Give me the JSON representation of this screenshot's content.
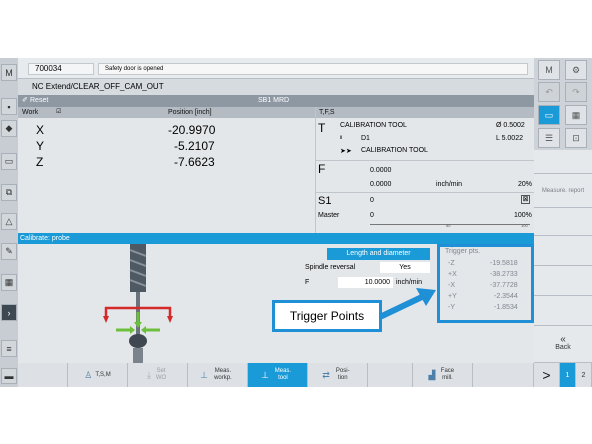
{
  "header": {
    "channel": "700034",
    "alarm": "Safety door is opened",
    "program": "NC Extend/CLEAR_OFF_CAM_OUT",
    "reset_label": "Reset",
    "mode": "SB1 MRD"
  },
  "position": {
    "col_work": "Work",
    "col_pos": "Position [inch]",
    "axes": [
      {
        "name": "X",
        "value": "-20.9970"
      },
      {
        "name": "Y",
        "value": "-5.2107"
      },
      {
        "name": "Z",
        "value": "-7.6623"
      }
    ]
  },
  "tfs": {
    "title": "T,F,S",
    "t_letter": "T",
    "tool": "CALIBRATION TOOL",
    "diameter": "Ø 0.5002",
    "d_num": "D1",
    "length": "L 5.0022",
    "next_tool": "CALIBRATION TOOL",
    "f_letter": "F",
    "f1": "0.0000",
    "f2": "0.0000",
    "f_unit": "inch/min",
    "f_pct": "20%",
    "s_letter": "S1",
    "s_val": "0",
    "master_label": "Master",
    "master_val": "0",
    "master_pct": "100%",
    "scale_mid": "50",
    "scale_max": "100"
  },
  "calib": {
    "title": "Calibrate: probe",
    "field_label": "Length and diameter",
    "spindle_label": "Spindle reversal",
    "spindle_value": "Yes",
    "f_label": "F",
    "f_value": "10.0000",
    "f_unit": "inch/min"
  },
  "trigger": {
    "title": "Trigger pts.",
    "points": [
      {
        "axis": "-Z",
        "value": "-19.5818"
      },
      {
        "axis": "+X",
        "value": "-38.2733"
      },
      {
        "axis": "-X",
        "value": "-37.7728"
      },
      {
        "axis": "+Y",
        "value": "-2.3544"
      },
      {
        "axis": "-Y",
        "value": "-1.8534"
      }
    ]
  },
  "callout": {
    "label": "Trigger Points"
  },
  "softkeys": {
    "measure_report": "Measure. report",
    "back": "Back"
  },
  "bottom": {
    "tsm": "T,S,M",
    "set_wo": "Set WO",
    "meas_workp": "Meas. workp.",
    "meas_tool": "Meas. tool",
    "position": "Posi- tion",
    "face_mill": "Face mill.",
    "page1": "1",
    "page2": "2"
  },
  "colors": {
    "accent": "#1a9ad6",
    "callout": "#1f8fd6",
    "probe_arrow_red": "#d42a2a",
    "probe_arrow_green": "#6bbf3a"
  }
}
